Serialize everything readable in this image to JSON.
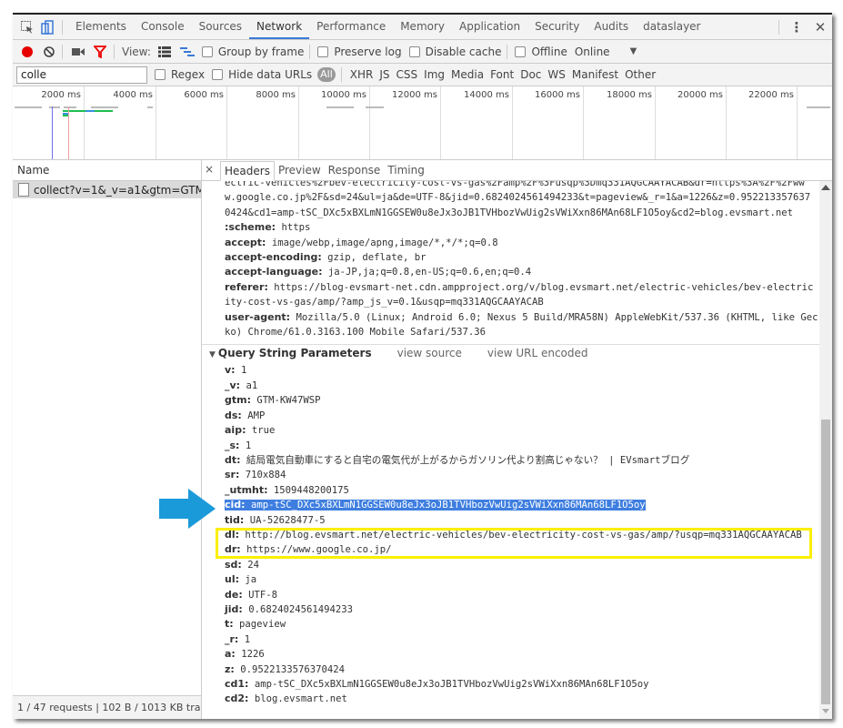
{
  "devtools_tabs": [
    {
      "label": "Elements",
      "active": false
    },
    {
      "label": "Console",
      "active": false
    },
    {
      "label": "Sources",
      "active": false
    },
    {
      "label": "Network",
      "active": true
    },
    {
      "label": "Performance",
      "active": false
    },
    {
      "label": "Memory",
      "active": false
    },
    {
      "label": "Application",
      "active": false
    },
    {
      "label": "Security",
      "active": false
    },
    {
      "label": "Audits",
      "active": false
    },
    {
      "label": "dataslayer",
      "active": false
    }
  ],
  "toolbar": {
    "view_label": "View:",
    "group_by_frame": "Group by frame",
    "preserve_log": "Preserve log",
    "disable_cache": "Disable cache",
    "offline": "Offline",
    "throttle": "Online"
  },
  "filter": {
    "value": "colle",
    "regex": "Regex",
    "hide_data_urls": "Hide data URLs",
    "all": "All",
    "types": [
      "XHR",
      "JS",
      "CSS",
      "Img",
      "Media",
      "Font",
      "Doc",
      "WS",
      "Manifest",
      "Other"
    ]
  },
  "overview": {
    "ticks": [
      "2000 ms",
      "4000 ms",
      "6000 ms",
      "8000 ms",
      "10000 ms",
      "12000 ms",
      "14000 ms",
      "16000 ms",
      "18000 ms",
      "20000 ms",
      "22000 ms"
    ],
    "dom_content_loaded_color": "#6f6ff0",
    "load_color": "#f0a0a0"
  },
  "requests": {
    "header": "Name",
    "items": [
      {
        "name": "collect?v=1&_v=a1&gtm=GTM-..."
      }
    ],
    "status": "1 / 47 requests  |  102 B / 1013 KB tra..."
  },
  "detail_tabs": [
    {
      "label": "Headers",
      "active": true
    },
    {
      "label": "Preview",
      "active": false
    },
    {
      "label": "Response",
      "active": false
    },
    {
      "label": "Timing",
      "active": false
    }
  ],
  "request_headers": {
    "continuation": [
      "ectric-vehicles%2Fbev-electricity-cost-vs-gas%2Famp%2F%3Fusqp%3Dmq331AQGCAAYACAB&dr=https%3A%2F%2Fww",
      "w.google.co.jp%2F&sd=24&ul=ja&de=UTF-8&jid=0.6824024561494233&t=pageview&_r=1&a=1226&z=0.952213357637",
      "0424&cd1=amp-tSC_DXc5xBXLmN1GGSEW0u8eJx3oJB1TVHbozVwUig2sVWiXxn86MAn68LF1O5oy&cd2=blog.evsmart.net"
    ],
    "items": [
      {
        "key": ":scheme:",
        "value": " https"
      },
      {
        "key": "accept:",
        "value": " image/webp,image/apng,image/*,*/*;q=0.8"
      },
      {
        "key": "accept-encoding:",
        "value": " gzip, deflate, br"
      },
      {
        "key": "accept-language:",
        "value": " ja-JP,ja;q=0.8,en-US;q=0.6,en;q=0.4"
      },
      {
        "key": "referer:",
        "value": " https://blog-evsmart-net.cdn.ampproject.org/v/blog.evsmart.net/electric-vehicles/bev-electric"
      },
      {
        "key": "",
        "value": "ity-cost-vs-gas/amp/?amp_js_v=0.1&usqp=mq331AQGCAAYACAB"
      },
      {
        "key": "user-agent:",
        "value": " Mozilla/5.0 (Linux; Android 6.0; Nexus 5 Build/MRA58N) AppleWebKit/537.36 (KHTML, like Gec"
      },
      {
        "key": "",
        "value": "ko) Chrome/61.0.3163.100 Mobile Safari/537.36"
      }
    ]
  },
  "query_string": {
    "title": "Query String Parameters",
    "view_source": "view source",
    "view_url_encoded": "view URL encoded",
    "params": [
      {
        "key": "v:",
        "value": " 1"
      },
      {
        "key": "_v:",
        "value": " a1"
      },
      {
        "key": "gtm:",
        "value": " GTM-KW47WSP"
      },
      {
        "key": "ds:",
        "value": " AMP"
      },
      {
        "key": "aip:",
        "value": " true"
      },
      {
        "key": "_s:",
        "value": " 1"
      },
      {
        "key": "dt:",
        "value": " 結局電気自動車にすると自宅の電気代が上がるからガソリン代より割高じゃない？ | EVsmartブログ"
      },
      {
        "key": "sr:",
        "value": " 710x884"
      },
      {
        "key": "_utmht:",
        "value": " 1509448200175"
      },
      {
        "key": "cid:",
        "value": " amp-tSC_DXc5xBXLmN1GGSEW0u8eJx3oJB1TVHbozVwUig2sVWiXxn86MAn68LF1O5oy",
        "highlighted": true
      },
      {
        "key": "tid:",
        "value": " UA-52628477-5"
      },
      {
        "key": "dl:",
        "value": " http://blog.evsmart.net/electric-vehicles/bev-electricity-cost-vs-gas/amp/?usqp=mq331AQGCAAYACAB"
      },
      {
        "key": "dr:",
        "value": " https://www.google.co.jp/"
      },
      {
        "key": "sd:",
        "value": " 24"
      },
      {
        "key": "ul:",
        "value": " ja"
      },
      {
        "key": "de:",
        "value": " UTF-8"
      },
      {
        "key": "jid:",
        "value": " 0.6824024561494233"
      },
      {
        "key": "t:",
        "value": " pageview"
      },
      {
        "key": "_r:",
        "value": " 1"
      },
      {
        "key": "a:",
        "value": " 1226"
      },
      {
        "key": "z:",
        "value": " 0.9522133576370424"
      },
      {
        "key": "cd1:",
        "value": " amp-tSC_DXc5xBXLmN1GGSEW0u8eJx3oJB1TVHbozVwUig2sVWiXxn86MAn68LF1O5oy"
      },
      {
        "key": "cd2:",
        "value": " blog.evsmart.net"
      }
    ]
  },
  "annotations": {
    "arrow_color": "#1a9ad9",
    "box_color": "#fbef00"
  }
}
